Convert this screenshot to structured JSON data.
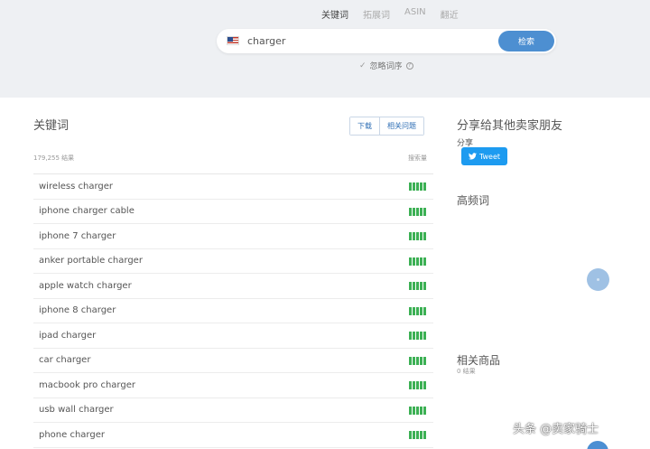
{
  "top_tabs": [
    "关键词",
    "拓展词",
    "ASIN",
    "翻近"
  ],
  "search": {
    "value": "charger",
    "button": "检索"
  },
  "ignore_order": "忽略词序",
  "left": {
    "title": "关键词",
    "download": "下载",
    "related_questions": "相关问题",
    "results": "179,255 结果",
    "volume_header": "搜索量",
    "keywords": [
      "wireless charger",
      "iphone charger cable",
      "iphone 7 charger",
      "anker portable charger",
      "apple watch charger",
      "iphone 8 charger",
      "ipad charger",
      "car charger",
      "macbook pro charger",
      "usb wall charger",
      "phone charger"
    ]
  },
  "right": {
    "share_title": "分享给其他卖家朋友",
    "share_label": "分享",
    "tweet": "Tweet",
    "freq_title": "高频词",
    "related_title": "相关商品",
    "related_count": "0 结果"
  },
  "watermark": "头条 @卖家骑士",
  "colors": {
    "accent": "#4d8fd1",
    "bars": "#3cb054",
    "tweet": "#1d9bf0"
  }
}
